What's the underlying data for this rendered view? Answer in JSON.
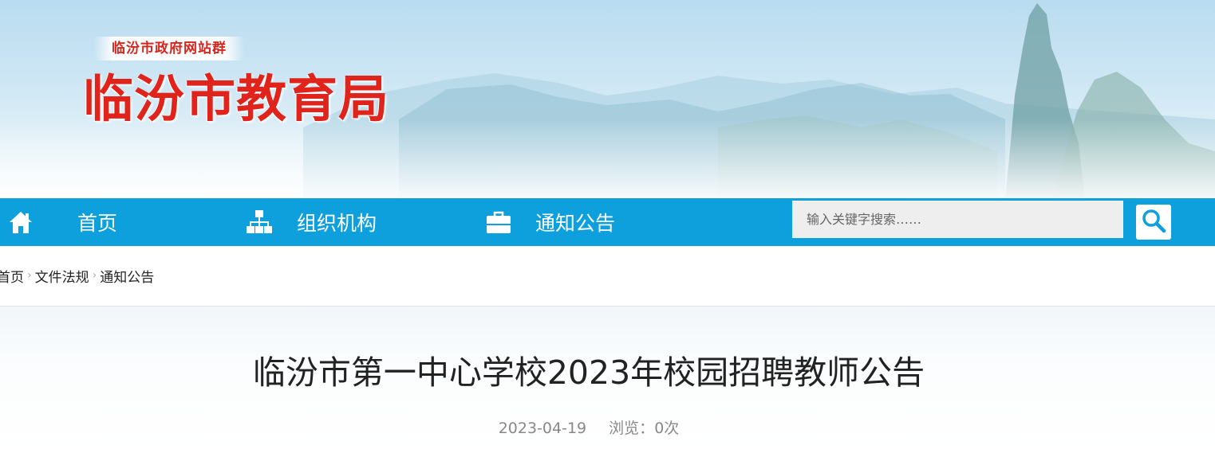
{
  "header": {
    "site_group": "临汾市政府网站群",
    "site_title": "临汾市教育局"
  },
  "nav": {
    "items": [
      {
        "label": "首页",
        "icon": "home-icon"
      },
      {
        "label": "组织机构",
        "icon": "org-chart-icon"
      },
      {
        "label": "通知公告",
        "icon": "briefcase-icon"
      }
    ],
    "search_placeholder": "输入关键字搜索……",
    "search_icon": "search-icon"
  },
  "breadcrumb": [
    "首页",
    "文件法规",
    "通知公告"
  ],
  "article": {
    "title": "临汾市第一中心学校2023年校园招聘教师公告",
    "date": "2023-04-19",
    "views_label": "浏览：",
    "views_count": "0",
    "views_unit": "次"
  },
  "colors": {
    "nav_bg": "#0ea0dd",
    "title_red": "#e0241b",
    "search_bg": "#eeeeee"
  }
}
